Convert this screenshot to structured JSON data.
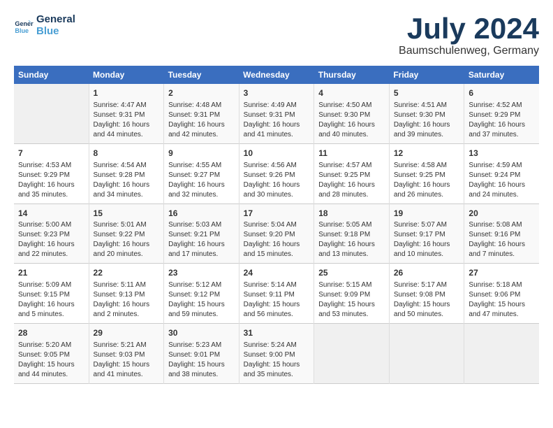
{
  "logo": {
    "line1": "General",
    "line2": "Blue"
  },
  "title": "July 2024",
  "location": "Baumschulenweg, Germany",
  "days_of_week": [
    "Sunday",
    "Monday",
    "Tuesday",
    "Wednesday",
    "Thursday",
    "Friday",
    "Saturday"
  ],
  "weeks": [
    [
      {
        "num": "",
        "info": ""
      },
      {
        "num": "1",
        "info": "Sunrise: 4:47 AM\nSunset: 9:31 PM\nDaylight: 16 hours\nand 44 minutes."
      },
      {
        "num": "2",
        "info": "Sunrise: 4:48 AM\nSunset: 9:31 PM\nDaylight: 16 hours\nand 42 minutes."
      },
      {
        "num": "3",
        "info": "Sunrise: 4:49 AM\nSunset: 9:31 PM\nDaylight: 16 hours\nand 41 minutes."
      },
      {
        "num": "4",
        "info": "Sunrise: 4:50 AM\nSunset: 9:30 PM\nDaylight: 16 hours\nand 40 minutes."
      },
      {
        "num": "5",
        "info": "Sunrise: 4:51 AM\nSunset: 9:30 PM\nDaylight: 16 hours\nand 39 minutes."
      },
      {
        "num": "6",
        "info": "Sunrise: 4:52 AM\nSunset: 9:29 PM\nDaylight: 16 hours\nand 37 minutes."
      }
    ],
    [
      {
        "num": "7",
        "info": "Sunrise: 4:53 AM\nSunset: 9:29 PM\nDaylight: 16 hours\nand 35 minutes."
      },
      {
        "num": "8",
        "info": "Sunrise: 4:54 AM\nSunset: 9:28 PM\nDaylight: 16 hours\nand 34 minutes."
      },
      {
        "num": "9",
        "info": "Sunrise: 4:55 AM\nSunset: 9:27 PM\nDaylight: 16 hours\nand 32 minutes."
      },
      {
        "num": "10",
        "info": "Sunrise: 4:56 AM\nSunset: 9:26 PM\nDaylight: 16 hours\nand 30 minutes."
      },
      {
        "num": "11",
        "info": "Sunrise: 4:57 AM\nSunset: 9:25 PM\nDaylight: 16 hours\nand 28 minutes."
      },
      {
        "num": "12",
        "info": "Sunrise: 4:58 AM\nSunset: 9:25 PM\nDaylight: 16 hours\nand 26 minutes."
      },
      {
        "num": "13",
        "info": "Sunrise: 4:59 AM\nSunset: 9:24 PM\nDaylight: 16 hours\nand 24 minutes."
      }
    ],
    [
      {
        "num": "14",
        "info": "Sunrise: 5:00 AM\nSunset: 9:23 PM\nDaylight: 16 hours\nand 22 minutes."
      },
      {
        "num": "15",
        "info": "Sunrise: 5:01 AM\nSunset: 9:22 PM\nDaylight: 16 hours\nand 20 minutes."
      },
      {
        "num": "16",
        "info": "Sunrise: 5:03 AM\nSunset: 9:21 PM\nDaylight: 16 hours\nand 17 minutes."
      },
      {
        "num": "17",
        "info": "Sunrise: 5:04 AM\nSunset: 9:20 PM\nDaylight: 16 hours\nand 15 minutes."
      },
      {
        "num": "18",
        "info": "Sunrise: 5:05 AM\nSunset: 9:18 PM\nDaylight: 16 hours\nand 13 minutes."
      },
      {
        "num": "19",
        "info": "Sunrise: 5:07 AM\nSunset: 9:17 PM\nDaylight: 16 hours\nand 10 minutes."
      },
      {
        "num": "20",
        "info": "Sunrise: 5:08 AM\nSunset: 9:16 PM\nDaylight: 16 hours\nand 7 minutes."
      }
    ],
    [
      {
        "num": "21",
        "info": "Sunrise: 5:09 AM\nSunset: 9:15 PM\nDaylight: 16 hours\nand 5 minutes."
      },
      {
        "num": "22",
        "info": "Sunrise: 5:11 AM\nSunset: 9:13 PM\nDaylight: 16 hours\nand 2 minutes."
      },
      {
        "num": "23",
        "info": "Sunrise: 5:12 AM\nSunset: 9:12 PM\nDaylight: 15 hours\nand 59 minutes."
      },
      {
        "num": "24",
        "info": "Sunrise: 5:14 AM\nSunset: 9:11 PM\nDaylight: 15 hours\nand 56 minutes."
      },
      {
        "num": "25",
        "info": "Sunrise: 5:15 AM\nSunset: 9:09 PM\nDaylight: 15 hours\nand 53 minutes."
      },
      {
        "num": "26",
        "info": "Sunrise: 5:17 AM\nSunset: 9:08 PM\nDaylight: 15 hours\nand 50 minutes."
      },
      {
        "num": "27",
        "info": "Sunrise: 5:18 AM\nSunset: 9:06 PM\nDaylight: 15 hours\nand 47 minutes."
      }
    ],
    [
      {
        "num": "28",
        "info": "Sunrise: 5:20 AM\nSunset: 9:05 PM\nDaylight: 15 hours\nand 44 minutes."
      },
      {
        "num": "29",
        "info": "Sunrise: 5:21 AM\nSunset: 9:03 PM\nDaylight: 15 hours\nand 41 minutes."
      },
      {
        "num": "30",
        "info": "Sunrise: 5:23 AM\nSunset: 9:01 PM\nDaylight: 15 hours\nand 38 minutes."
      },
      {
        "num": "31",
        "info": "Sunrise: 5:24 AM\nSunset: 9:00 PM\nDaylight: 15 hours\nand 35 minutes."
      },
      {
        "num": "",
        "info": ""
      },
      {
        "num": "",
        "info": ""
      },
      {
        "num": "",
        "info": ""
      }
    ]
  ]
}
